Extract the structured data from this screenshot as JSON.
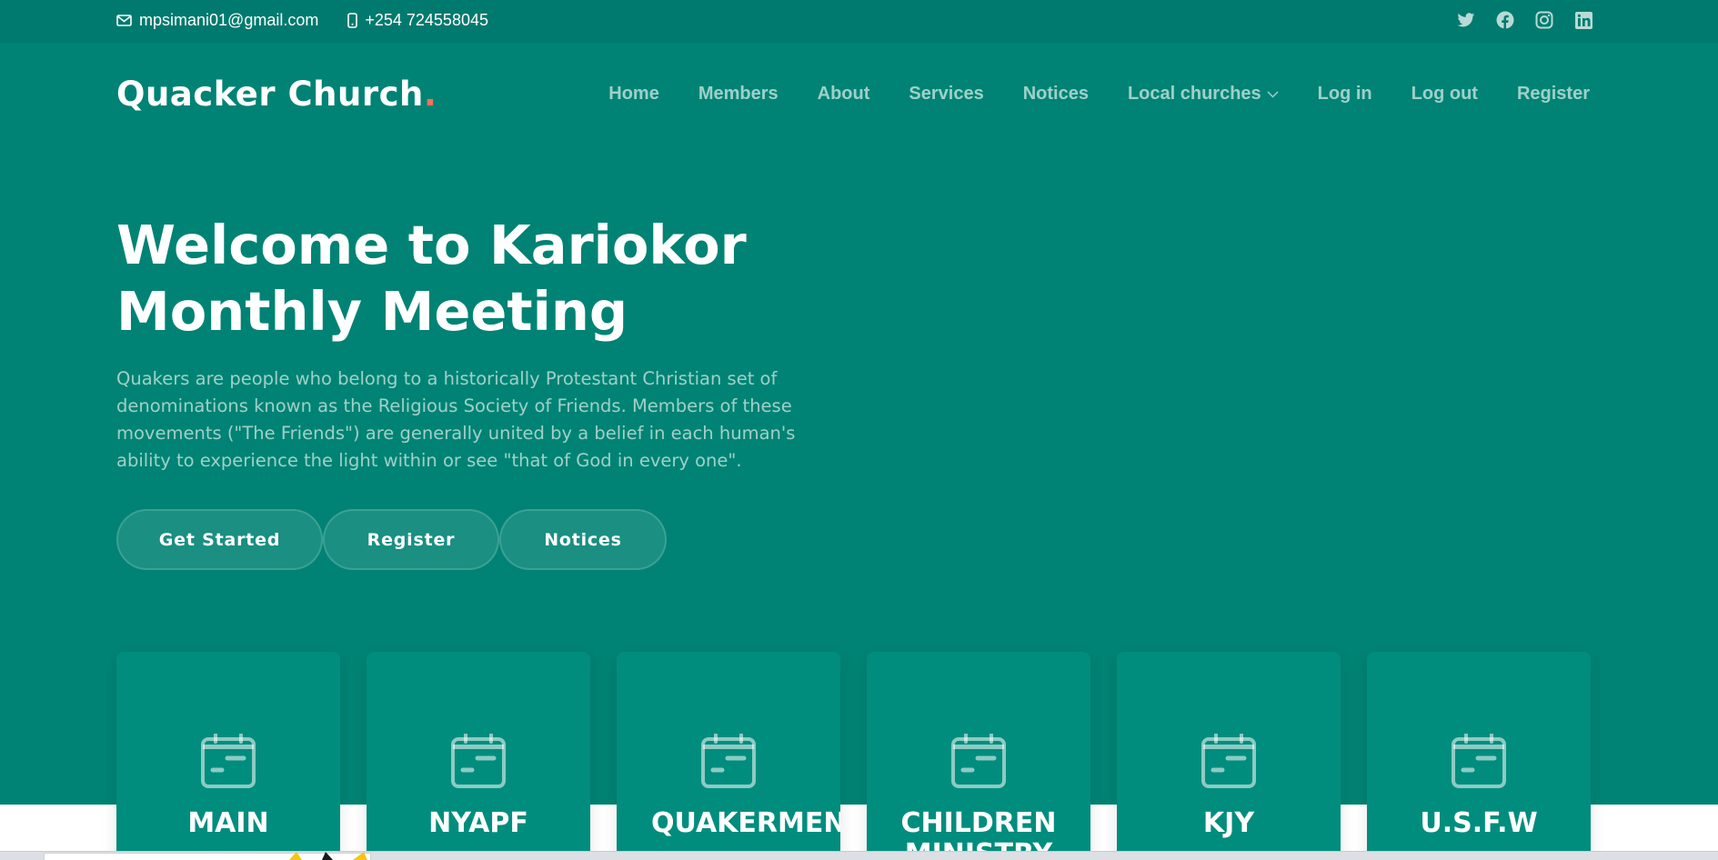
{
  "topbar": {
    "email": "mpsimani01@gmail.com",
    "phone": "+254 724558045",
    "email_icon": "envelope-icon",
    "phone_icon": "phone-icon",
    "social": [
      "twitter-icon",
      "facebook-icon",
      "instagram-icon",
      "linkedin-icon"
    ]
  },
  "header": {
    "logo_text": "Quacker Church",
    "logo_dot": "."
  },
  "nav": {
    "items": [
      {
        "label": "Home"
      },
      {
        "label": "Members"
      },
      {
        "label": "About"
      },
      {
        "label": "Services"
      },
      {
        "label": "Notices"
      },
      {
        "label": "Local churches",
        "dropdown": true
      },
      {
        "label": "Log in"
      },
      {
        "label": "Log out"
      },
      {
        "label": "Register"
      }
    ]
  },
  "hero": {
    "title_line1": "Welcome to Kariokor",
    "title_line2": "Monthly Meeting",
    "text": "Quakers are people who belong to a historically Protestant Christian set of denominations known as the Religious Society of Friends. Members of these movements (\"The Friends\") are generally united by a belief in each human's ability to experience the light within or see \"that of God in every one\".",
    "buttons": {
      "get_started": "Get Started",
      "register": "Register",
      "notices": "Notices"
    }
  },
  "cards": [
    {
      "title": "MAIN",
      "icon": "calendar-icon"
    },
    {
      "title": "NYAPF",
      "icon": "calendar-icon"
    },
    {
      "title": "QUAKERMEN",
      "icon": "calendar-icon"
    },
    {
      "title": "CHILDREN MINISTRY",
      "icon": "calendar-icon"
    },
    {
      "title": "KJY",
      "icon": "calendar-icon"
    },
    {
      "title": "U.S.F.W",
      "icon": "calendar-icon"
    }
  ],
  "colors": {
    "topbar": "#007a6e",
    "hero": "#008374",
    "card": "#008d7d",
    "logo_dot": "#f96f59"
  }
}
